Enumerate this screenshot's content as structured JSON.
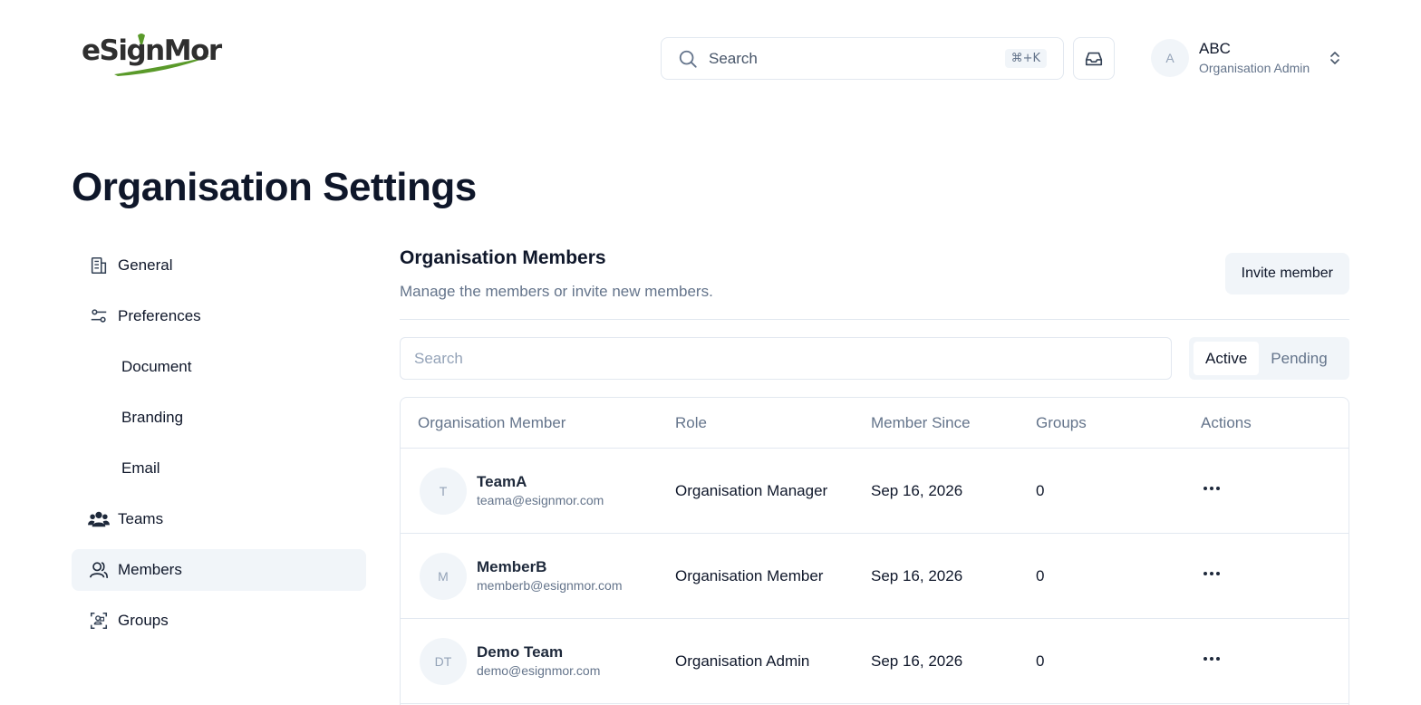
{
  "header": {
    "logo_text": "eSignMor",
    "search_placeholder": "Search",
    "search_shortcut": "⌘+K",
    "user": {
      "initial": "A",
      "name": "ABC",
      "role": "Organisation Admin"
    }
  },
  "page_title": "Organisation Settings",
  "sidebar": {
    "items": [
      {
        "label": "General",
        "icon": "building-icon"
      },
      {
        "label": "Preferences",
        "icon": "sliders-icon"
      },
      {
        "label": "Document"
      },
      {
        "label": "Branding"
      },
      {
        "label": "Email"
      },
      {
        "label": "Teams",
        "icon": "users-icon"
      },
      {
        "label": "Members",
        "icon": "user-icon",
        "active": true
      },
      {
        "label": "Groups",
        "icon": "group-icon"
      }
    ]
  },
  "main": {
    "title": "Organisation Members",
    "description": "Manage the members or invite new members.",
    "invite_label": "Invite member",
    "search_placeholder": "Search",
    "tabs": [
      {
        "label": "Active",
        "active": true
      },
      {
        "label": "Pending"
      }
    ],
    "table": {
      "columns": [
        "Organisation Member",
        "Role",
        "Member Since",
        "Groups",
        "Actions"
      ],
      "rows": [
        {
          "initials": "T",
          "name": "TeamA",
          "email": "teama@esignmor.com",
          "role": "Organisation Manager",
          "since": "Sep 16, 2026",
          "groups": "0"
        },
        {
          "initials": "M",
          "name": "MemberB",
          "email": "memberb@esignmor.com",
          "role": "Organisation Member",
          "since": "Sep 16, 2026",
          "groups": "0"
        },
        {
          "initials": "DT",
          "name": "Demo Team",
          "email": "demo@esignmor.com",
          "role": "Organisation Admin",
          "since": "Sep 16, 2026",
          "groups": "0"
        }
      ]
    }
  },
  "colors": {
    "accent_green": "#5a9a2a",
    "muted_bg": "#f1f5f9",
    "border": "#e2e8f0",
    "text_muted": "#64748b"
  }
}
